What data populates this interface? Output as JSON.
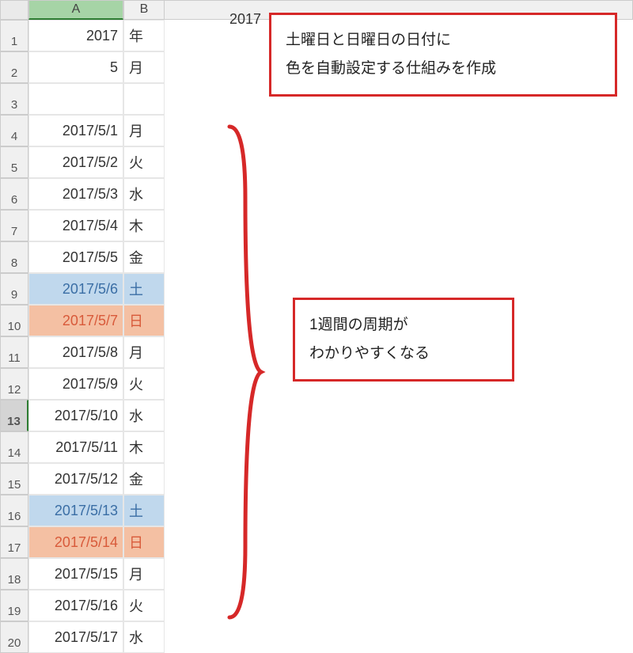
{
  "columns": {
    "A": "A",
    "B": "B"
  },
  "partialC": "2017",
  "header": {
    "year": "2017",
    "year_label": "年",
    "month": "5",
    "month_label": "月"
  },
  "rows": [
    {
      "n": "1",
      "a": "2017",
      "b": "年",
      "cls": ""
    },
    {
      "n": "2",
      "a": "5",
      "b": "月",
      "cls": ""
    },
    {
      "n": "3",
      "a": "",
      "b": "",
      "cls": ""
    },
    {
      "n": "4",
      "a": "2017/5/1",
      "b": "月",
      "cls": ""
    },
    {
      "n": "5",
      "a": "2017/5/2",
      "b": "火",
      "cls": ""
    },
    {
      "n": "6",
      "a": "2017/5/3",
      "b": "水",
      "cls": ""
    },
    {
      "n": "7",
      "a": "2017/5/4",
      "b": "木",
      "cls": ""
    },
    {
      "n": "8",
      "a": "2017/5/5",
      "b": "金",
      "cls": ""
    },
    {
      "n": "9",
      "a": "2017/5/6",
      "b": "土",
      "cls": "sat"
    },
    {
      "n": "10",
      "a": "2017/5/7",
      "b": "日",
      "cls": "sun"
    },
    {
      "n": "11",
      "a": "2017/5/8",
      "b": "月",
      "cls": ""
    },
    {
      "n": "12",
      "a": "2017/5/9",
      "b": "火",
      "cls": ""
    },
    {
      "n": "13",
      "a": "2017/5/10",
      "b": "水",
      "cls": "",
      "active": true
    },
    {
      "n": "14",
      "a": "2017/5/11",
      "b": "木",
      "cls": ""
    },
    {
      "n": "15",
      "a": "2017/5/12",
      "b": "金",
      "cls": ""
    },
    {
      "n": "16",
      "a": "2017/5/13",
      "b": "土",
      "cls": "sat"
    },
    {
      "n": "17",
      "a": "2017/5/14",
      "b": "日",
      "cls": "sun"
    },
    {
      "n": "18",
      "a": "2017/5/15",
      "b": "月",
      "cls": ""
    },
    {
      "n": "19",
      "a": "2017/5/16",
      "b": "火",
      "cls": ""
    },
    {
      "n": "20",
      "a": "2017/5/17",
      "b": "水",
      "cls": ""
    }
  ],
  "annotation1_line1": "土曜日と日曜日の日付に",
  "annotation1_line2": "色を自動設定する仕組みを作成",
  "annotation2_line1": "1週間の周期が",
  "annotation2_line2": "わかりやすくなる"
}
